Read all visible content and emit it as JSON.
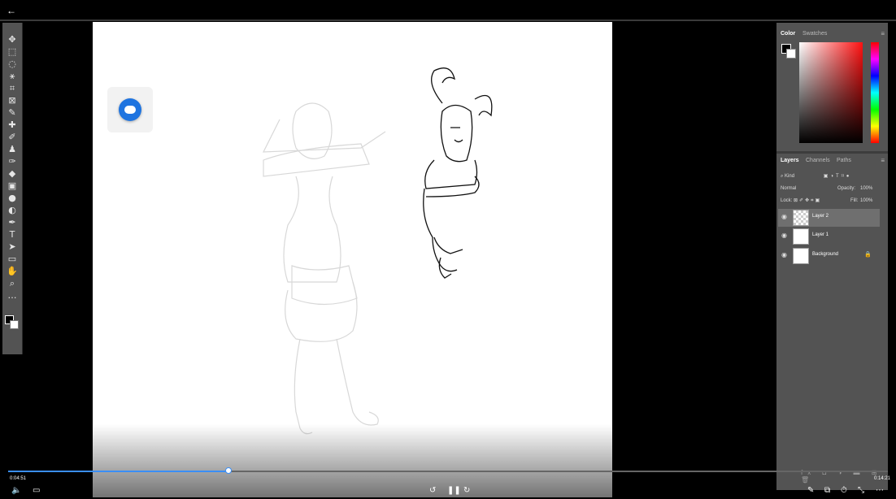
{
  "nav": {
    "back_icon": "arrow-left-icon"
  },
  "tools": [
    {
      "name": "move-tool-icon",
      "glyph": "✥"
    },
    {
      "name": "marquee-tool-icon",
      "glyph": "⬚"
    },
    {
      "name": "lasso-tool-icon",
      "glyph": "◌"
    },
    {
      "name": "magic-wand-icon",
      "glyph": "⚹"
    },
    {
      "name": "crop-tool-icon",
      "glyph": "⌗"
    },
    {
      "name": "frame-tool-icon",
      "glyph": "⊠"
    },
    {
      "name": "eyedropper-icon",
      "glyph": "✎"
    },
    {
      "name": "healing-brush-icon",
      "glyph": "✚"
    },
    {
      "name": "brush-tool-icon",
      "glyph": "✐"
    },
    {
      "name": "clone-stamp-icon",
      "glyph": "♟"
    },
    {
      "name": "history-brush-icon",
      "glyph": "✑"
    },
    {
      "name": "eraser-icon",
      "glyph": "◆"
    },
    {
      "name": "gradient-tool-icon",
      "glyph": "▣"
    },
    {
      "name": "blur-tool-icon",
      "glyph": "●"
    },
    {
      "name": "dodge-tool-icon",
      "glyph": "◐"
    },
    {
      "name": "pen-tool-icon",
      "glyph": "✒"
    },
    {
      "name": "type-tool-icon",
      "glyph": "T"
    },
    {
      "name": "path-selection-icon",
      "glyph": "➤"
    },
    {
      "name": "rectangle-tool-icon",
      "glyph": "▭"
    },
    {
      "name": "hand-tool-icon",
      "glyph": "✋"
    },
    {
      "name": "zoom-tool-icon",
      "glyph": "⌕"
    },
    {
      "name": "more-tools-icon",
      "glyph": "…"
    }
  ],
  "color_panel": {
    "tabs": [
      "Color",
      "Swatches"
    ],
    "foreground": "#000000",
    "background": "#ffffff"
  },
  "layers_panel": {
    "tabs": [
      "Layers",
      "Channels",
      "Paths"
    ],
    "filter_label": "Kind",
    "blend_mode": "Normal",
    "opacity_label": "Opacity:",
    "opacity_value": "100%",
    "lock_label": "Lock:",
    "fill_label": "Fill:",
    "fill_value": "100%",
    "layers": [
      {
        "name": "Layer 2",
        "selected": true,
        "transparent": true,
        "locked": false
      },
      {
        "name": "Layer 1",
        "selected": false,
        "transparent": false,
        "locked": false
      },
      {
        "name": "Background",
        "selected": false,
        "transparent": false,
        "locked": true
      }
    ]
  },
  "player": {
    "current_time": "0:04:51",
    "remaining_time": "0:14:21",
    "progress": 0.25,
    "accent": "#3a8ef6"
  }
}
